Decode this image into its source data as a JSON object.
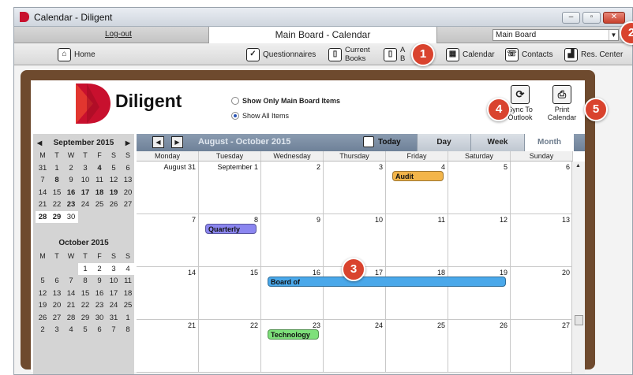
{
  "window": {
    "title": "Calendar - Diligent"
  },
  "menubar": {
    "logout": "Log-out",
    "board_tab": "Main Board - Calendar",
    "board_select": "Main Board"
  },
  "nav": [
    {
      "label": "Home",
      "icon": "home-icon"
    },
    {
      "label": "Questionnaires",
      "icon": "questionnaire-icon"
    },
    {
      "label1": "Current",
      "label2": "Books",
      "icon": "book-icon"
    },
    {
      "label1": "A",
      "label2": "B",
      "icon": "archive-book-icon"
    },
    {
      "label": "Calendar",
      "icon": "calendar-icon"
    },
    {
      "label": "Contacts",
      "icon": "phone-icon"
    },
    {
      "label": "Res. Center",
      "icon": "chart-icon"
    }
  ],
  "brand": {
    "name": "Diligent",
    "color": "#c8102e"
  },
  "filters": {
    "option1": "Show Only Main Board Items",
    "option2": "Show All Items",
    "selected": "option2"
  },
  "actions": {
    "sync1": "Sync To",
    "sync2": "Outlook",
    "print1": "Print",
    "print2": "Calendar"
  },
  "mini_calendars": [
    {
      "title": "September 2015",
      "days": [
        [
          31,
          1,
          2,
          3,
          4,
          5,
          6
        ],
        [
          7,
          8,
          9,
          10,
          11,
          12,
          13
        ],
        [
          14,
          15,
          16,
          17,
          18,
          19,
          20
        ],
        [
          21,
          22,
          23,
          24,
          25,
          26,
          27
        ],
        [
          28,
          29,
          30,
          "",
          "",
          "",
          ""
        ]
      ]
    },
    {
      "title": "October 2015",
      "days": [
        [
          "",
          "",
          "",
          1,
          2,
          3,
          4
        ],
        [
          5,
          6,
          7,
          8,
          9,
          10,
          11
        ],
        [
          12,
          13,
          14,
          15,
          16,
          17,
          18
        ],
        [
          19,
          20,
          21,
          22,
          23,
          24,
          25
        ],
        [
          26,
          27,
          28,
          29,
          30,
          31,
          1
        ],
        [
          2,
          3,
          4,
          5,
          6,
          7,
          8
        ]
      ]
    }
  ],
  "weekday_letters": [
    "M",
    "T",
    "W",
    "T",
    "F",
    "S",
    "S"
  ],
  "calendar": {
    "range": "August - October 2015",
    "today": "Today",
    "views": [
      "Day",
      "Week",
      "Month"
    ],
    "selected_view": "Month",
    "weekdays": [
      "Monday",
      "Tuesday",
      "Wednesday",
      "Thursday",
      "Friday",
      "Saturday",
      "Sunday"
    ],
    "weeks": [
      [
        "August 31",
        "September 1",
        "2",
        "3",
        "4",
        "5",
        "6"
      ],
      [
        "7",
        "8",
        "9",
        "10",
        "11",
        "12",
        "13"
      ],
      [
        "14",
        "15",
        "16",
        "17",
        "18",
        "19",
        "20"
      ],
      [
        "21",
        "22",
        "23",
        "24",
        "25",
        "26",
        "27"
      ]
    ],
    "events": [
      {
        "label": "Audit",
        "week": 0,
        "day": 4,
        "span": 1,
        "color": "#f3b54a"
      },
      {
        "label": "Quarterly",
        "week": 1,
        "day": 1,
        "span": 1,
        "color": "#8b86f0"
      },
      {
        "label": "Board of",
        "week": 2,
        "day": 2,
        "span": 4,
        "color": "#4aa8ea"
      },
      {
        "label": "Technology",
        "week": 3,
        "day": 2,
        "span": 1,
        "color": "#7ee07a"
      }
    ]
  },
  "callouts": [
    "1",
    "2",
    "3",
    "4",
    "5"
  ],
  "accent": "#d9432e"
}
